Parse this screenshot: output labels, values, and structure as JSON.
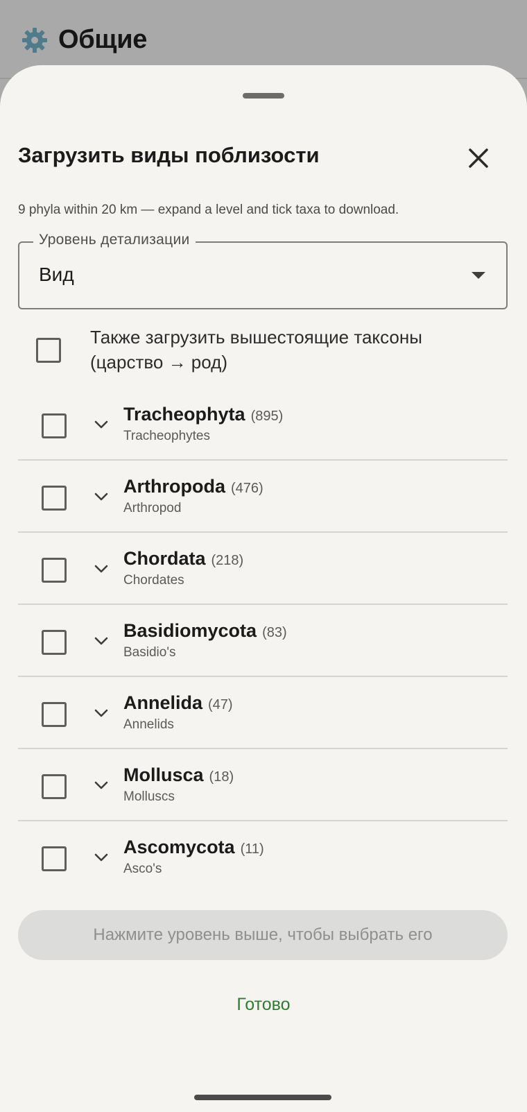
{
  "background": {
    "title": "Общие",
    "icon": "gear-icon"
  },
  "sheet": {
    "title": "Загрузить виды поблизости",
    "subtitle": "9 phyla within 20 km — expand a level and tick taxa to download.",
    "detail_level": {
      "label": "Уровень детализации",
      "value": "Вид"
    },
    "also_download": {
      "label": "Также загрузить вышестоящие таксоны (царство → род)",
      "checked": false
    },
    "taxa": [
      {
        "name": "Tracheophyta",
        "count": "(895)",
        "common": "Tracheophytes",
        "checked": false
      },
      {
        "name": "Arthropoda",
        "count": "(476)",
        "common": "Arthropod",
        "checked": false
      },
      {
        "name": "Chordata",
        "count": "(218)",
        "common": "Chordates",
        "checked": false
      },
      {
        "name": "Basidiomycota",
        "count": "(83)",
        "common": "Basidio's",
        "checked": false
      },
      {
        "name": "Annelida",
        "count": "(47)",
        "common": "Annelids",
        "checked": false
      },
      {
        "name": "Mollusca",
        "count": "(18)",
        "common": "Molluscs",
        "checked": false
      },
      {
        "name": "Ascomycota",
        "count": "(11)",
        "common": "Asco's",
        "checked": false
      }
    ],
    "primary_button": "Нажмите уровень выше, чтобы выбрать его",
    "done_button": "Готово"
  },
  "colors": {
    "accent_green": "#2e7d32",
    "sheet_bg": "#f5f4f0",
    "scrim": "#a9a9a9"
  }
}
